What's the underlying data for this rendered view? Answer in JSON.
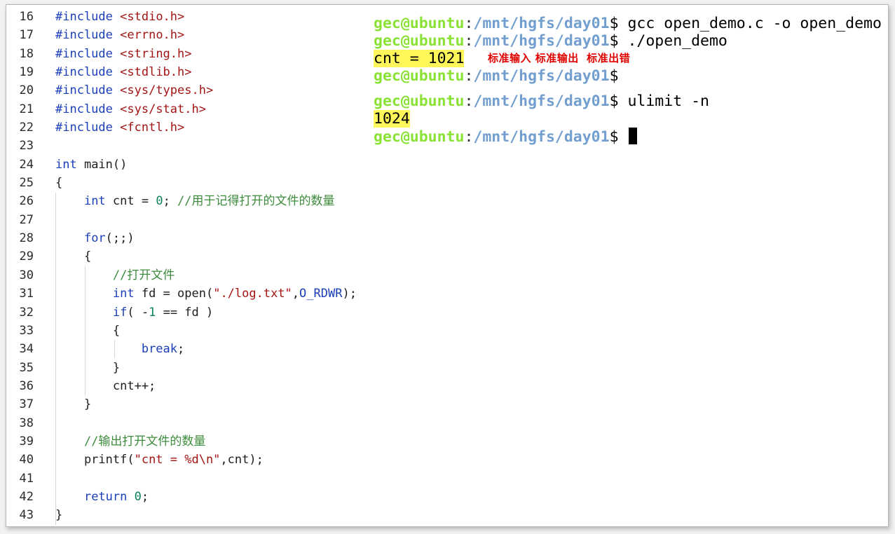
{
  "editor": {
    "line_numbers": [
      "16",
      "17",
      "18",
      "19",
      "20",
      "21",
      "22",
      "23",
      "24",
      "25",
      "26",
      "27",
      "28",
      "29",
      "30",
      "31",
      "32",
      "33",
      "34",
      "35",
      "36",
      "37",
      "38",
      "39",
      "40",
      "41",
      "42",
      "43"
    ],
    "lines": [
      [
        {
          "t": "#include",
          "c": "pp"
        },
        {
          "t": " "
        },
        {
          "t": "<stdio.h>",
          "c": "hdr"
        }
      ],
      [
        {
          "t": "#include",
          "c": "pp"
        },
        {
          "t": " "
        },
        {
          "t": "<errno.h>",
          "c": "hdr"
        }
      ],
      [
        {
          "t": "#include",
          "c": "pp"
        },
        {
          "t": " "
        },
        {
          "t": "<string.h>",
          "c": "hdr"
        }
      ],
      [
        {
          "t": "#include",
          "c": "pp"
        },
        {
          "t": " "
        },
        {
          "t": "<stdlib.h>",
          "c": "hdr"
        }
      ],
      [
        {
          "t": "#include",
          "c": "pp"
        },
        {
          "t": " "
        },
        {
          "t": "<sys/types.h>",
          "c": "hdr"
        }
      ],
      [
        {
          "t": "#include",
          "c": "pp"
        },
        {
          "t": " "
        },
        {
          "t": "<sys/stat.h>",
          "c": "hdr"
        }
      ],
      [
        {
          "t": "#include",
          "c": "pp"
        },
        {
          "t": " "
        },
        {
          "t": "<fcntl.h>",
          "c": "hdr"
        }
      ],
      [],
      [
        {
          "t": "int",
          "c": "kw"
        },
        {
          "t": " main()"
        }
      ],
      [
        {
          "t": "{"
        }
      ],
      [
        {
          "t": "    "
        },
        {
          "t": "int",
          "c": "kw"
        },
        {
          "t": " cnt = "
        },
        {
          "t": "0",
          "c": "num"
        },
        {
          "t": "; "
        },
        {
          "t": "//用于记得打开的文件的数量",
          "c": "cm"
        }
      ],
      [],
      [
        {
          "t": "    "
        },
        {
          "t": "for",
          "c": "kw"
        },
        {
          "t": "(;;)"
        }
      ],
      [
        {
          "t": "    {"
        }
      ],
      [
        {
          "t": "        "
        },
        {
          "t": "//打开文件",
          "c": "cm"
        }
      ],
      [
        {
          "t": "        "
        },
        {
          "t": "int",
          "c": "kw"
        },
        {
          "t": " fd = open("
        },
        {
          "t": "\"./log.txt\"",
          "c": "str"
        },
        {
          "t": ","
        },
        {
          "t": "O_RDWR",
          "c": "mac"
        },
        {
          "t": ");"
        }
      ],
      [
        {
          "t": "        "
        },
        {
          "t": "if",
          "c": "kw"
        },
        {
          "t": "( -"
        },
        {
          "t": "1",
          "c": "num"
        },
        {
          "t": " == fd )"
        }
      ],
      [
        {
          "t": "        {"
        }
      ],
      [
        {
          "t": "            "
        },
        {
          "t": "break",
          "c": "kw"
        },
        {
          "t": ";"
        }
      ],
      [
        {
          "t": "        }"
        }
      ],
      [
        {
          "t": "        cnt++;"
        }
      ],
      [
        {
          "t": "    }"
        }
      ],
      [],
      [
        {
          "t": "    "
        },
        {
          "t": "//输出打开文件的数量",
          "c": "cm"
        }
      ],
      [
        {
          "t": "    printf("
        },
        {
          "t": "\"cnt = %d\\n\"",
          "c": "str"
        },
        {
          "t": ",cnt);"
        }
      ],
      [],
      [
        {
          "t": "    "
        },
        {
          "t": "return",
          "c": "kw"
        },
        {
          "t": " "
        },
        {
          "t": "0",
          "c": "num"
        },
        {
          "t": ";"
        }
      ],
      [
        {
          "t": "}"
        }
      ]
    ]
  },
  "terminal": {
    "prompt_user": "gec@ubuntu",
    "prompt_colon": ":",
    "prompt_path": "/mnt/hgfs/day01",
    "prompt_dollar": "$",
    "cmd1": " gcc open_demo.c -o open_demo",
    "cmd2": " ./open_demo",
    "output1": "cnt = 1021",
    "note": "标准输入 标准输出  标准出错",
    "cmd3": " ulimit -n",
    "output2": "1024"
  },
  "colors": {
    "keyword": "#1a3fb8",
    "string": "#a31515",
    "comment": "#3d8b3d",
    "number": "#098658",
    "prompt_user": "#8ae234",
    "prompt_path": "#729fcf",
    "highlight": "#fff75a",
    "note": "#e00000"
  }
}
